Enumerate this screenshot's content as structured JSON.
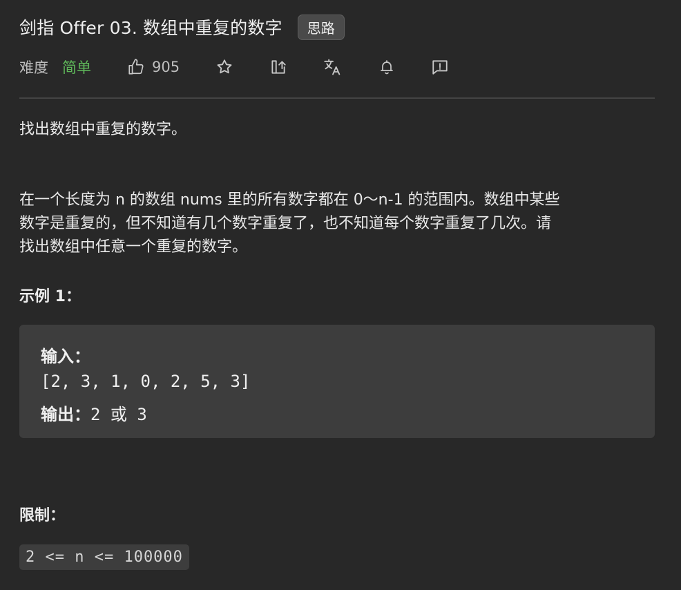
{
  "problem": {
    "title": "剑指 Offer 03. 数组中重复的数字",
    "tag": "思路",
    "difficulty_label": "难度",
    "difficulty_value": "简单",
    "likes": "905"
  },
  "toolbar_icons": [
    "thumbs-up-icon",
    "star-icon",
    "share-icon",
    "translate-icon",
    "bell-icon",
    "feedback-icon"
  ],
  "description": {
    "line1": "找出数组中重复的数字。",
    "para2_line1": "在一个长度为 n 的数组 nums 里的所有数字都在 0～n-1 的范围内。数组中某些",
    "para2_line2": "数字是重复的，但不知道有几个数字重复了，也不知道每个数字重复了几次。请",
    "para2_line3": "找出数组中任意一个重复的数字。"
  },
  "example": {
    "heading": "示例 1：",
    "input_label": "输入：",
    "input_value": "[2, 3, 1, 0, 2, 5, 3]",
    "output_label": "输出：",
    "output_value": "2 或 3"
  },
  "constraints": {
    "heading": "限制：",
    "value": "2 <= n <= 100000"
  },
  "colors": {
    "background": "#282828",
    "difficulty_easy": "#5fb85a",
    "code_block": "#3d3d3d"
  }
}
